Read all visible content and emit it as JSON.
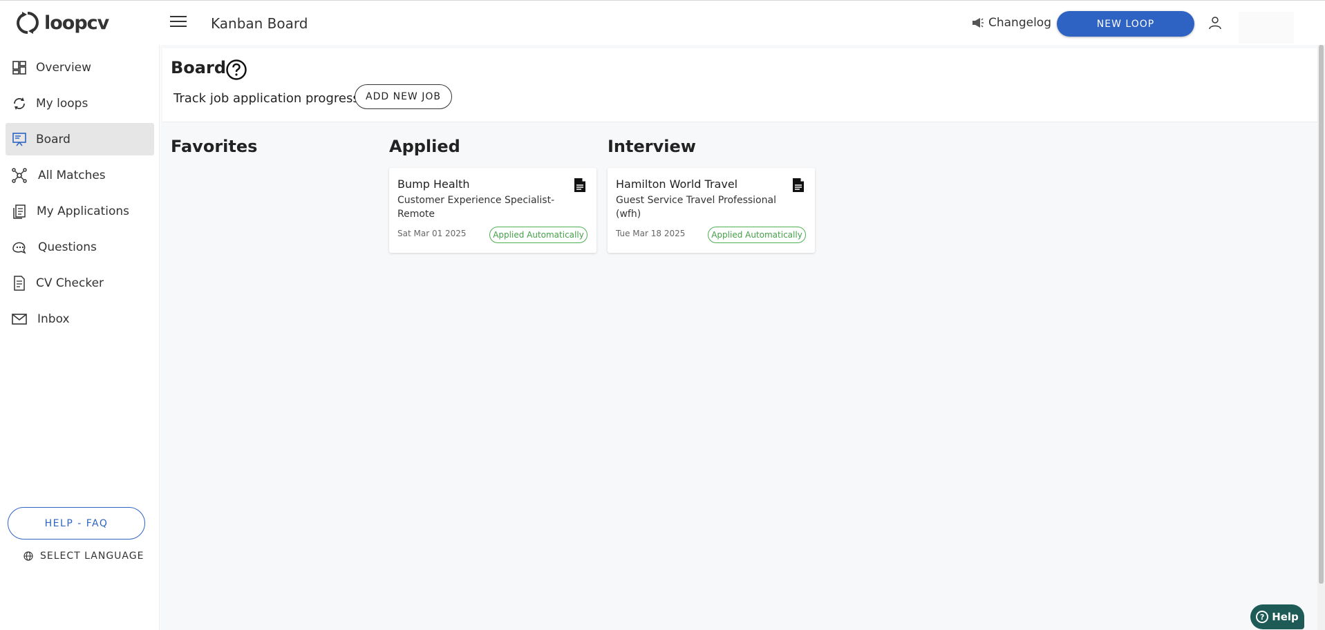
{
  "app": {
    "logo_text": "loopcv"
  },
  "header": {
    "title": "Kanban Board",
    "changelog_label": "Changelog",
    "new_loop_label": "NEW LOOP"
  },
  "sidebar": {
    "items": [
      {
        "label": "Overview",
        "icon": "overview-icon"
      },
      {
        "label": "My loops",
        "icon": "loop-icon"
      },
      {
        "label": "Board",
        "icon": "board-icon"
      },
      {
        "label": "All Matches",
        "icon": "matches-icon"
      },
      {
        "label": "My Applications",
        "icon": "applications-icon"
      },
      {
        "label": "Questions",
        "icon": "questions-icon"
      },
      {
        "label": "CV Checker",
        "icon": "cv-checker-icon"
      },
      {
        "label": "Inbox",
        "icon": "inbox-icon"
      }
    ],
    "active_item": "Board",
    "help_faq_label": "HELP - FAQ",
    "language_label": "SELECT LANGUAGE"
  },
  "board": {
    "title": "Board",
    "subtitle": "Track job application progress",
    "add_job_label": "ADD NEW JOB",
    "columns": [
      {
        "title": "Favorites",
        "cards": []
      },
      {
        "title": "Applied",
        "cards": [
          {
            "company": "Bump Health",
            "role": "Customer Experience Specialist- Remote",
            "date": "Sat Mar 01 2025",
            "status": "Applied Automatically"
          }
        ]
      },
      {
        "title": "Interview",
        "cards": [
          {
            "company": "Hamilton World Travel",
            "role": "Guest Service Travel Professional (wfh)",
            "date": "Tue Mar 18 2025",
            "status": "Applied Automatically"
          }
        ]
      }
    ]
  },
  "help_widget": {
    "label": "Help"
  },
  "colors": {
    "primary": "#2e63c3",
    "success": "#43a047",
    "help_widget": "#1e5b57"
  }
}
